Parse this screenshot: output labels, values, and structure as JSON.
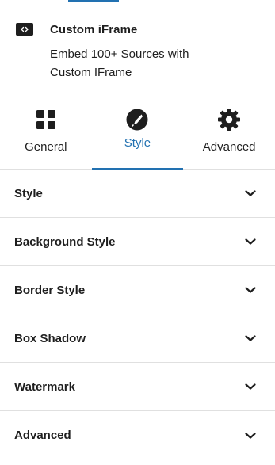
{
  "block": {
    "icon": "iframe-embed-icon",
    "title": "Custom iFrame",
    "description": "Embed 100+ Sources with Custom IFrame"
  },
  "tabs": [
    {
      "label": "General",
      "icon": "grid-icon",
      "active": false
    },
    {
      "label": "Style",
      "icon": "brush-icon",
      "active": true
    },
    {
      "label": "Advanced",
      "icon": "gear-icon",
      "active": false
    }
  ],
  "panels": [
    {
      "title": "Style"
    },
    {
      "title": "Background Style"
    },
    {
      "title": "Border Style"
    },
    {
      "title": "Box Shadow"
    },
    {
      "title": "Watermark"
    },
    {
      "title": "Advanced"
    }
  ],
  "colors": {
    "accent": "#2271b1",
    "text": "#1e1e1e",
    "divider": "#e0e0e0"
  }
}
